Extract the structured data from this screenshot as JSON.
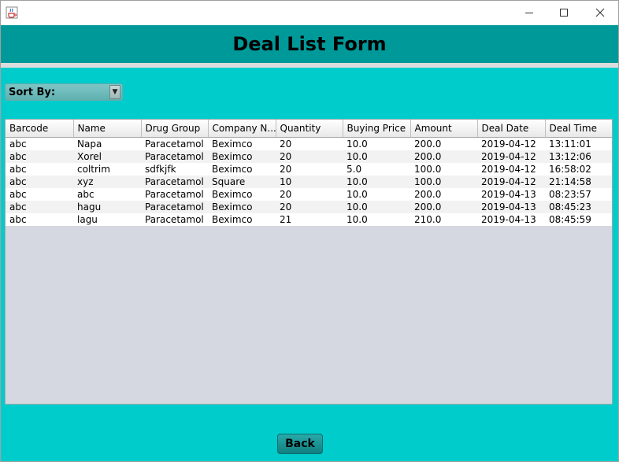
{
  "window": {
    "icon": "java-cup-icon",
    "controls": [
      "minimize-icon",
      "maximize-icon",
      "close-icon"
    ]
  },
  "header": {
    "title": "Deal List Form"
  },
  "sort": {
    "label": "Sort By:",
    "icon": "dropdown-arrow-icon"
  },
  "table": {
    "columns": [
      "Barcode",
      "Name",
      "Drug Group",
      "Company N...",
      "Quantity",
      "Buying  Price",
      "Amount",
      "Deal Date",
      "Deal Time"
    ],
    "rows": [
      [
        "abc",
        "Napa",
        "Paracetamol",
        "Beximco",
        "20",
        "10.0",
        "200.0",
        "2019-04-12",
        "13:11:01"
      ],
      [
        "abc",
        "Xorel",
        "Paracetamol",
        "Beximco",
        "20",
        "10.0",
        "200.0",
        "2019-04-12",
        "13:12:06"
      ],
      [
        "abc",
        "coltrim",
        "sdfkjfk",
        "Beximco",
        "20",
        "5.0",
        "100.0",
        "2019-04-12",
        "16:58:02"
      ],
      [
        "abc",
        "xyz",
        "Paracetamol",
        "Square",
        "10",
        "10.0",
        "100.0",
        "2019-04-12",
        "21:14:58"
      ],
      [
        "abc",
        "abc",
        "Paracetamol",
        "Beximco",
        "20",
        "10.0",
        "200.0",
        "2019-04-13",
        "08:23:57"
      ],
      [
        "abc",
        "hagu",
        "Paracetamol",
        "Beximco",
        "20",
        "10.0",
        "200.0",
        "2019-04-13",
        "08:45:23"
      ],
      [
        "abc",
        "lagu",
        "Paracetamol",
        "Beximco",
        "21",
        "10.0",
        "210.0",
        "2019-04-13",
        "08:45:59"
      ]
    ]
  },
  "footer": {
    "back_label": "Back"
  },
  "colors": {
    "background": "#00cccc",
    "header_band": "#009999",
    "button": "#1a8f8f"
  }
}
